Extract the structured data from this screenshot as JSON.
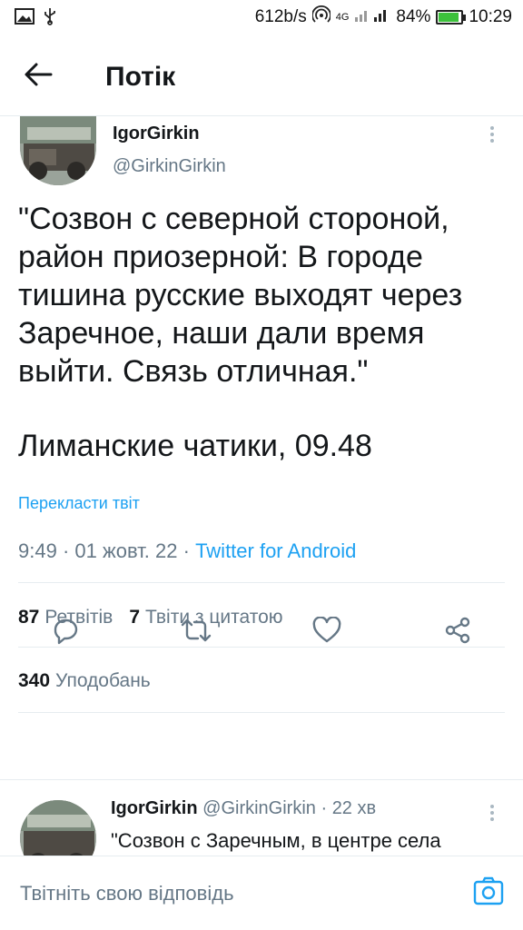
{
  "status_bar": {
    "net_speed": "612b/s",
    "network_type": "4G",
    "battery_percent": "84%",
    "time": "10:29",
    "icons": [
      "image-icon",
      "usb-icon",
      "hotspot-icon",
      "signal-icon",
      "battery-icon"
    ]
  },
  "app_bar": {
    "title": "Потік",
    "back_icon": "arrow-left-icon"
  },
  "tweet": {
    "author_name": "IgorGirkin",
    "author_handle": "@GirkinGirkin",
    "text_para1": "\"Созвон с северной стороной, район приозерной: В городе тишина русские выходят через Заречное, наши дали время выйти. Связь отличная.\"",
    "text_para2": "Лиманские чатики, 09.48",
    "translate_label": "Перекласти твіт",
    "time": "9:49",
    "date": "01 жовт. 22",
    "source": "Twitter for Android",
    "retweets_count": "87",
    "retweets_label": "Ретвітів",
    "quotes_count": "7",
    "quotes_label": "Твіти з цитатою",
    "likes_count": "340",
    "likes_label": "Уподобань"
  },
  "actions": {
    "icons": [
      "reply-icon",
      "retweet-icon",
      "like-icon",
      "share-icon"
    ]
  },
  "reply_tweet": {
    "author_name": "IgorGirkin",
    "author_handle": "@GirkinGirkin",
    "age": "22 хв",
    "text": "\"Созвон с Заречным, в центре села"
  },
  "reply_bar": {
    "placeholder": "Твітніть свою відповідь",
    "camera_icon": "camera-icon"
  },
  "colors": {
    "accent": "#1da1f2",
    "secondary_text": "#657786",
    "primary_text": "#14171a",
    "battery_fill": "#3cc13b"
  }
}
